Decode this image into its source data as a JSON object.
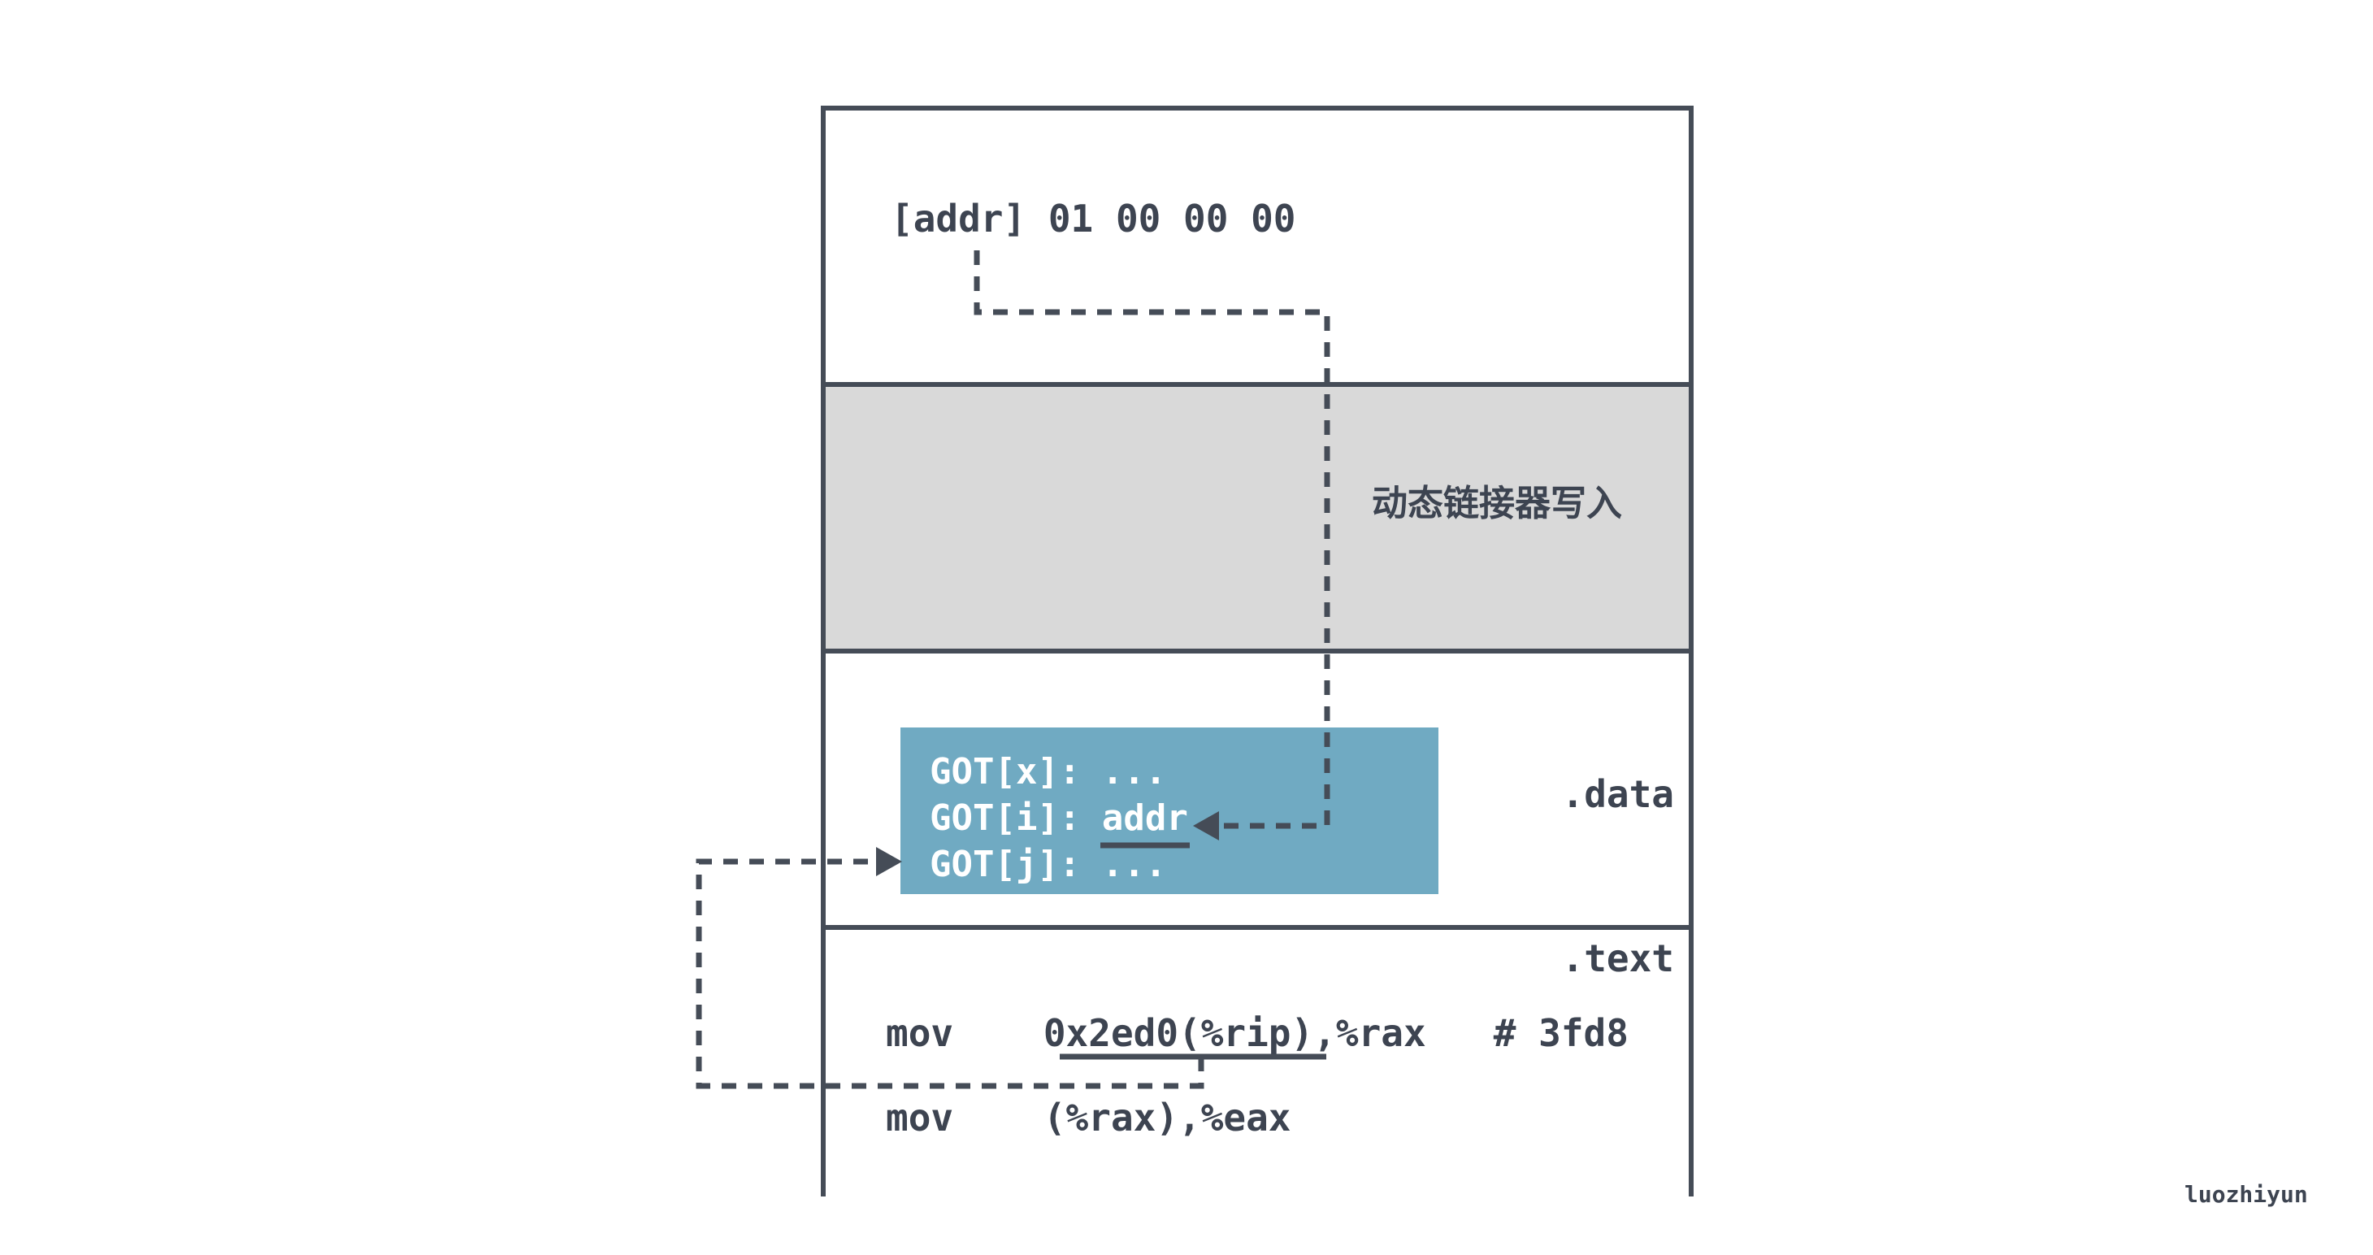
{
  "top_section": {
    "text": "[addr] 01 00 00 00"
  },
  "gray_section": {
    "label": "动态链接器写入"
  },
  "data_section": {
    "label": ".data",
    "got_entries": [
      "GOT[x]: ...",
      "GOT[i]: addr",
      "GOT[j]: ..."
    ]
  },
  "text_section": {
    "label": ".text",
    "lines": [
      "mov    0x2ed0(%rip),%rax   # 3fd8",
      "mov    (%rax),%eax"
    ]
  },
  "watermark": "luozhiyun",
  "colors": {
    "border": "#454c57",
    "gray_fill": "#d9d9d9",
    "got_fill": "#70aac2",
    "text": "#3d4451"
  }
}
